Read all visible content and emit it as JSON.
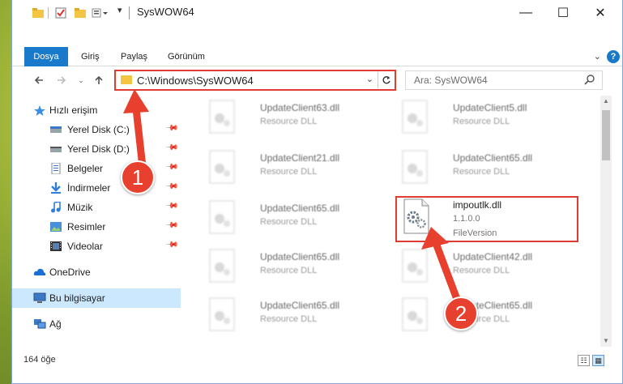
{
  "window": {
    "title": "SysWOW64",
    "controls": {
      "minimize": "—",
      "maximize": "☐",
      "close": "✕"
    }
  },
  "ribbon": {
    "tabs": [
      {
        "label": "Dosya",
        "active": true
      },
      {
        "label": "Giriş"
      },
      {
        "label": "Paylaş"
      },
      {
        "label": "Görünüm"
      }
    ],
    "help": "?",
    "accent": "#1979ca"
  },
  "address": {
    "path": "C:\\Windows\\SysWOW64",
    "search_placeholder": "Ara: SysWOW64"
  },
  "nav": {
    "items": [
      {
        "label": "Hızlı erişim",
        "icon": "star-icon"
      },
      {
        "label": "Yerel Disk (C:)",
        "icon": "drive-icon",
        "pinned": true
      },
      {
        "label": "Yerel Disk (D:)",
        "icon": "drive-icon",
        "pinned": true
      },
      {
        "label": "Belgeler",
        "icon": "document-icon",
        "pinned": true
      },
      {
        "label": "İndirmeler",
        "icon": "download-icon",
        "pinned": true
      },
      {
        "label": "Müzik",
        "icon": "music-icon",
        "pinned": true
      },
      {
        "label": "Resimler",
        "icon": "pictures-icon",
        "pinned": true
      },
      {
        "label": "Videolar",
        "icon": "video-icon",
        "pinned": true
      },
      {
        "label": "OneDrive",
        "icon": "cloud-icon"
      },
      {
        "label": "Bu bilgisayar",
        "icon": "computer-icon",
        "selected": true
      },
      {
        "label": "Ağ",
        "icon": "network-icon"
      }
    ]
  },
  "files": [
    {
      "name": "UpdateClient63.dll",
      "desc": "Resource DLL"
    },
    {
      "name": "UpdateClient5.dll",
      "desc": "Resource DLL"
    },
    {
      "name": "UpdateClient21.dll",
      "desc": "Resource DLL"
    },
    {
      "name": "UpdateClient65.dll",
      "desc": "Resource DLL"
    },
    {
      "name": "UpdateClient65.dll",
      "desc": "Resource DLL"
    },
    {
      "name": "impoutlk.dll",
      "desc": "1.1.0.0",
      "desc2": "FileVersion",
      "focus": true
    },
    {
      "name": "UpdateClient65.dll",
      "desc": "Resource DLL"
    },
    {
      "name": "UpdateClient42.dll",
      "desc": "Resource DLL"
    },
    {
      "name": "UpdateClient65.dll",
      "desc": "Resource DLL"
    },
    {
      "name": "UpdateClient65.dll",
      "desc": "Resource DLL"
    }
  ],
  "status": {
    "count": "164 öğe"
  },
  "annotations": {
    "step1": "1",
    "step2": "2",
    "color": "#e8402e"
  }
}
